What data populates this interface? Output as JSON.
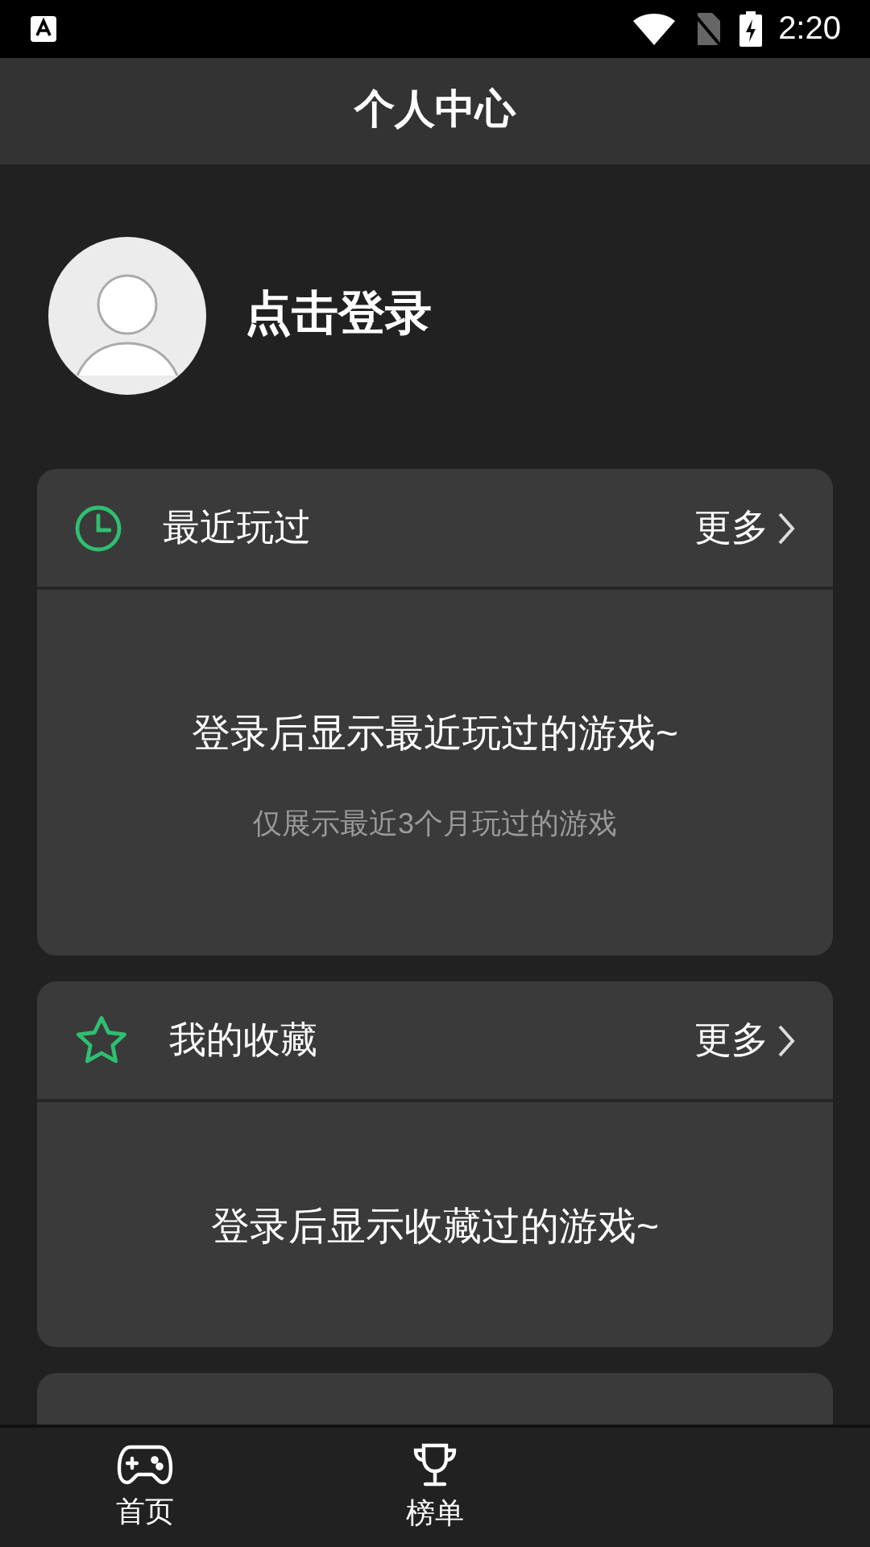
{
  "status_bar": {
    "time": "2:20"
  },
  "header": {
    "title": "个人中心"
  },
  "profile": {
    "login_label": "点击登录"
  },
  "sections": [
    {
      "kind": "recent",
      "title": "最近玩过",
      "more": "更多",
      "message": "登录后显示最近玩过的游戏~",
      "hint": "仅展示最近3个月玩过的游戏"
    },
    {
      "kind": "favorites",
      "title": "我的收藏",
      "more": "更多",
      "message": "登录后显示收藏过的游戏~"
    }
  ],
  "bottom_nav": [
    {
      "kind": "home",
      "label": "首页"
    },
    {
      "kind": "ranking",
      "label": "榜单"
    }
  ]
}
